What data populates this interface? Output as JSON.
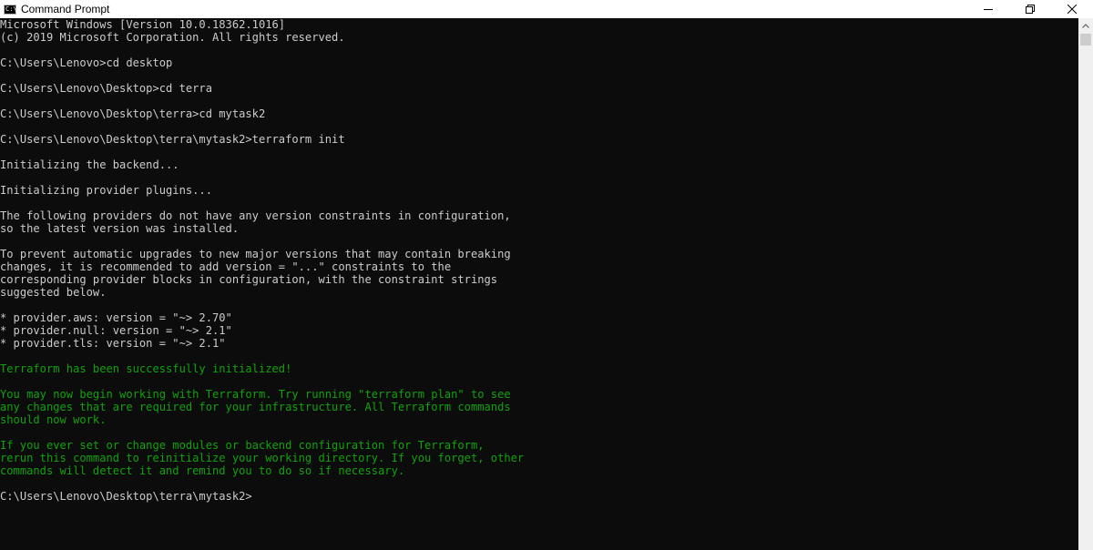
{
  "window": {
    "title": "Command Prompt",
    "icon_glyph": "C:\\",
    "icons": {
      "app": "command-prompt-icon",
      "minimize": "minimize-icon",
      "maximize": "restore-icon",
      "close": "close-icon",
      "scroll_up": "chevron-up-icon"
    }
  },
  "colors": {
    "background": "#0c0c0c",
    "text": "#cccccc",
    "success": "#13a10e"
  },
  "console": {
    "lines": [
      {
        "text": "Microsoft Windows [Version 10.0.18362.1016]",
        "style": "default"
      },
      {
        "text": "(c) 2019 Microsoft Corporation. All rights reserved.",
        "style": "default"
      },
      {
        "text": "",
        "style": "default"
      },
      {
        "text": "C:\\Users\\Lenovo>cd desktop",
        "style": "default"
      },
      {
        "text": "",
        "style": "default"
      },
      {
        "text": "C:\\Users\\Lenovo\\Desktop>cd terra",
        "style": "default"
      },
      {
        "text": "",
        "style": "default"
      },
      {
        "text": "C:\\Users\\Lenovo\\Desktop\\terra>cd mytask2",
        "style": "default"
      },
      {
        "text": "",
        "style": "default"
      },
      {
        "text": "C:\\Users\\Lenovo\\Desktop\\terra\\mytask2>terraform init",
        "style": "default"
      },
      {
        "text": "",
        "style": "default"
      },
      {
        "text": "Initializing the backend...",
        "style": "default"
      },
      {
        "text": "",
        "style": "default"
      },
      {
        "text": "Initializing provider plugins...",
        "style": "default"
      },
      {
        "text": "",
        "style": "default"
      },
      {
        "text": "The following providers do not have any version constraints in configuration,",
        "style": "default"
      },
      {
        "text": "so the latest version was installed.",
        "style": "default"
      },
      {
        "text": "",
        "style": "default"
      },
      {
        "text": "To prevent automatic upgrades to new major versions that may contain breaking",
        "style": "default"
      },
      {
        "text": "changes, it is recommended to add version = \"...\" constraints to the",
        "style": "default"
      },
      {
        "text": "corresponding provider blocks in configuration, with the constraint strings",
        "style": "default"
      },
      {
        "text": "suggested below.",
        "style": "default"
      },
      {
        "text": "",
        "style": "default"
      },
      {
        "text": "* provider.aws: version = \"~> 2.70\"",
        "style": "default"
      },
      {
        "text": "* provider.null: version = \"~> 2.1\"",
        "style": "default"
      },
      {
        "text": "* provider.tls: version = \"~> 2.1\"",
        "style": "default"
      },
      {
        "text": "",
        "style": "default"
      },
      {
        "text": "Terraform has been successfully initialized!",
        "style": "green"
      },
      {
        "text": "",
        "style": "default"
      },
      {
        "text": "You may now begin working with Terraform. Try running \"terraform plan\" to see",
        "style": "green"
      },
      {
        "text": "any changes that are required for your infrastructure. All Terraform commands",
        "style": "green"
      },
      {
        "text": "should now work.",
        "style": "green"
      },
      {
        "text": "",
        "style": "default"
      },
      {
        "text": "If you ever set or change modules or backend configuration for Terraform,",
        "style": "green"
      },
      {
        "text": "rerun this command to reinitialize your working directory. If you forget, other",
        "style": "green"
      },
      {
        "text": "commands will detect it and remind you to do so if necessary.",
        "style": "green"
      },
      {
        "text": "",
        "style": "default"
      },
      {
        "text": "C:\\Users\\Lenovo\\Desktop\\terra\\mytask2>",
        "style": "default"
      }
    ]
  }
}
